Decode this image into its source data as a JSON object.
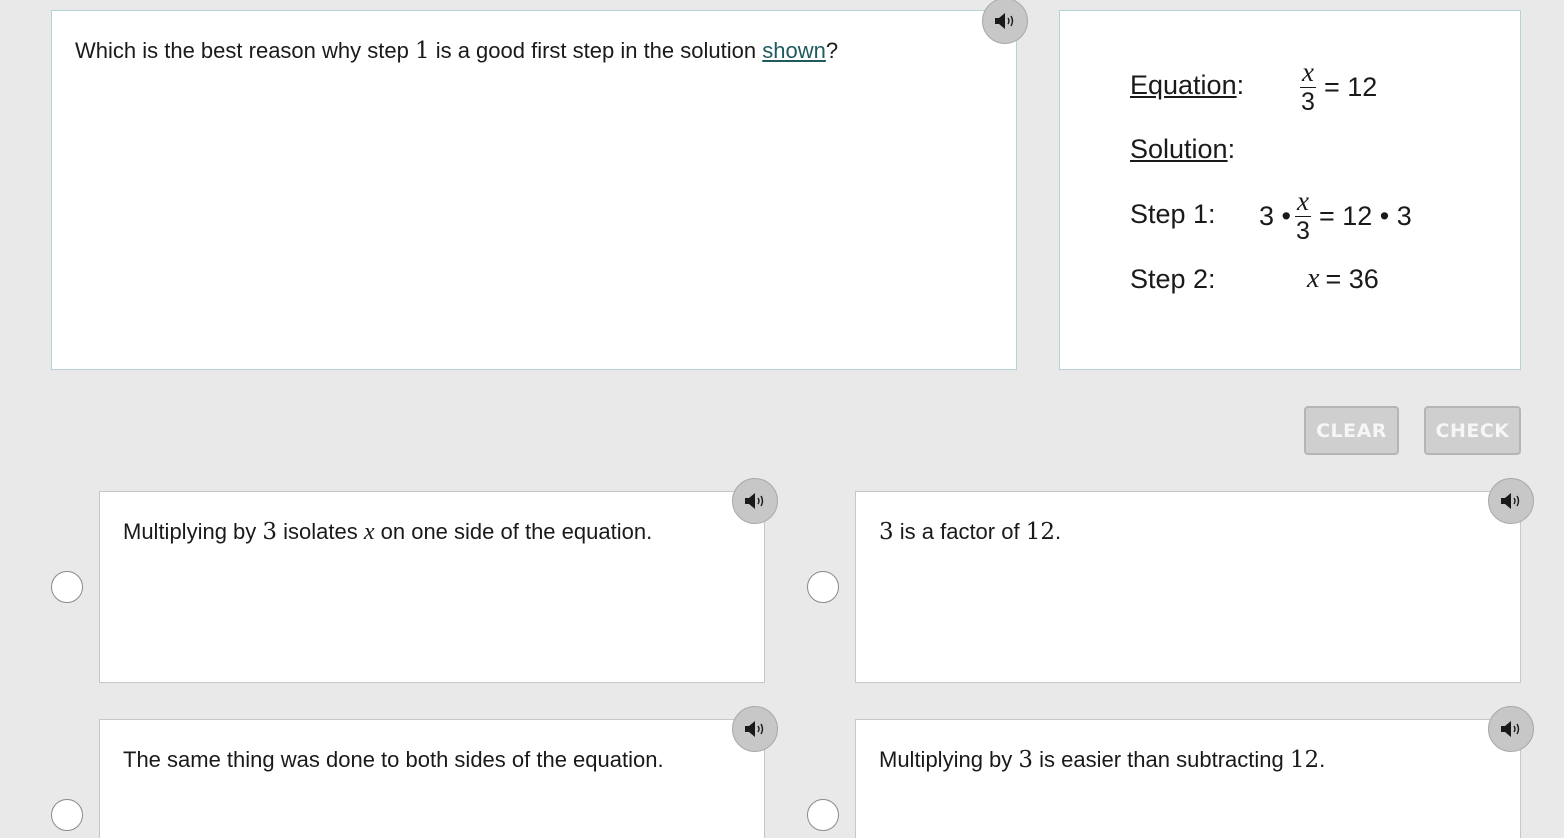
{
  "question": {
    "prefix": "Which is the best reason why step ",
    "step_number": "1",
    "middle": " is a good first step in the solution ",
    "link_text": "shown",
    "suffix": "?"
  },
  "solution": {
    "equation_label": "Equation",
    "equation_colon": ":",
    "equation_numerator": "x",
    "equation_denominator": "3",
    "equation_rhs": "= 12",
    "solution_label": "Solution",
    "solution_colon": ":",
    "step1_label": "Step 1:",
    "step1_lhs": "3 •",
    "step1_numerator": "x",
    "step1_denominator": "3",
    "step1_rhs": "= 12 • 3",
    "step2_label": "Step 2:",
    "step2_var": "x",
    "step2_rhs": "= 36"
  },
  "buttons": {
    "clear_label": "CLEAR",
    "check_label": "CHECK"
  },
  "options": {
    "a": {
      "pre": "Multiplying by ",
      "num": "3",
      "mid": " isolates ",
      "var": "x",
      "post": " on one side of the equation."
    },
    "b": {
      "num1": "3",
      "mid": " is a factor of ",
      "num2": "12",
      "post": "."
    },
    "c": {
      "text": "The same thing was done to both sides of the equation."
    },
    "d": {
      "pre": "Multiplying by ",
      "num1": "3",
      "mid": " is easier than subtracting ",
      "num2": "12",
      "post": "."
    }
  },
  "icons": {
    "speaker": "speaker-icon"
  },
  "colors": {
    "link": "#1f5a5f",
    "panel_border": "#b7d3d8",
    "button_bg": "#cfcfcf"
  }
}
